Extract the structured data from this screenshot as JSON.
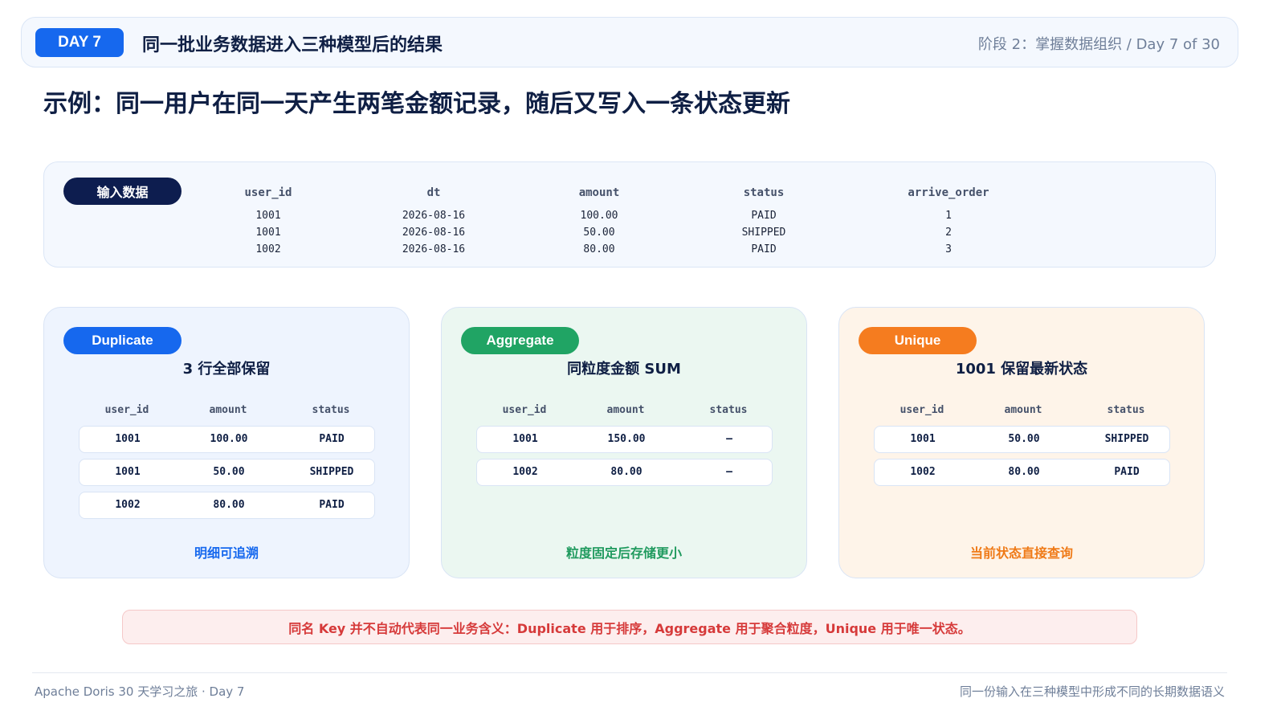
{
  "header": {
    "day_badge": "DAY 7",
    "title": "同一批业务数据进入三种模型后的结果",
    "progress": "阶段 2：掌握数据组织 / Day 7 of 30"
  },
  "page_title": "示例：同一用户在同一天产生两笔金额记录，随后又写入一条状态更新",
  "input": {
    "label": "输入数据",
    "columns": [
      "user_id",
      "dt",
      "amount",
      "status",
      "arrive_order"
    ],
    "rows": [
      [
        "1001",
        "2026-08-16",
        "100.00",
        "PAID",
        "1"
      ],
      [
        "1001",
        "2026-08-16",
        "50.00",
        "SHIPPED",
        "2"
      ],
      [
        "1002",
        "2026-08-16",
        "80.00",
        "PAID",
        "3"
      ]
    ]
  },
  "cards": {
    "duplicate": {
      "label": "Duplicate",
      "subtitle": "3 行全部保留",
      "columns": [
        "user_id",
        "amount",
        "status"
      ],
      "rows": [
        [
          "1001",
          "100.00",
          "PAID"
        ],
        [
          "1001",
          "50.00",
          "SHIPPED"
        ],
        [
          "1002",
          "80.00",
          "PAID"
        ]
      ],
      "footer": "明细可追溯"
    },
    "aggregate": {
      "label": "Aggregate",
      "subtitle": "同粒度金额 SUM",
      "columns": [
        "user_id",
        "amount",
        "status"
      ],
      "rows": [
        [
          "1001",
          "150.00",
          "—"
        ],
        [
          "1002",
          "80.00",
          "—"
        ]
      ],
      "footer": "粒度固定后存储更小"
    },
    "unique": {
      "label": "Unique",
      "subtitle": "1001 保留最新状态",
      "columns": [
        "user_id",
        "amount",
        "status"
      ],
      "rows": [
        [
          "1001",
          "50.00",
          "SHIPPED"
        ],
        [
          "1002",
          "80.00",
          "PAID"
        ]
      ],
      "footer": "当前状态直接查询"
    }
  },
  "note": "同名 Key 并不自动代表同一业务含义：Duplicate 用于排序，Aggregate 用于聚合粒度，Unique 用于唯一状态。",
  "footer": {
    "left": "Apache Doris 30 天学习之旅 · Day 7",
    "right": "同一份输入在三种模型中形成不同的长期数据语义"
  }
}
